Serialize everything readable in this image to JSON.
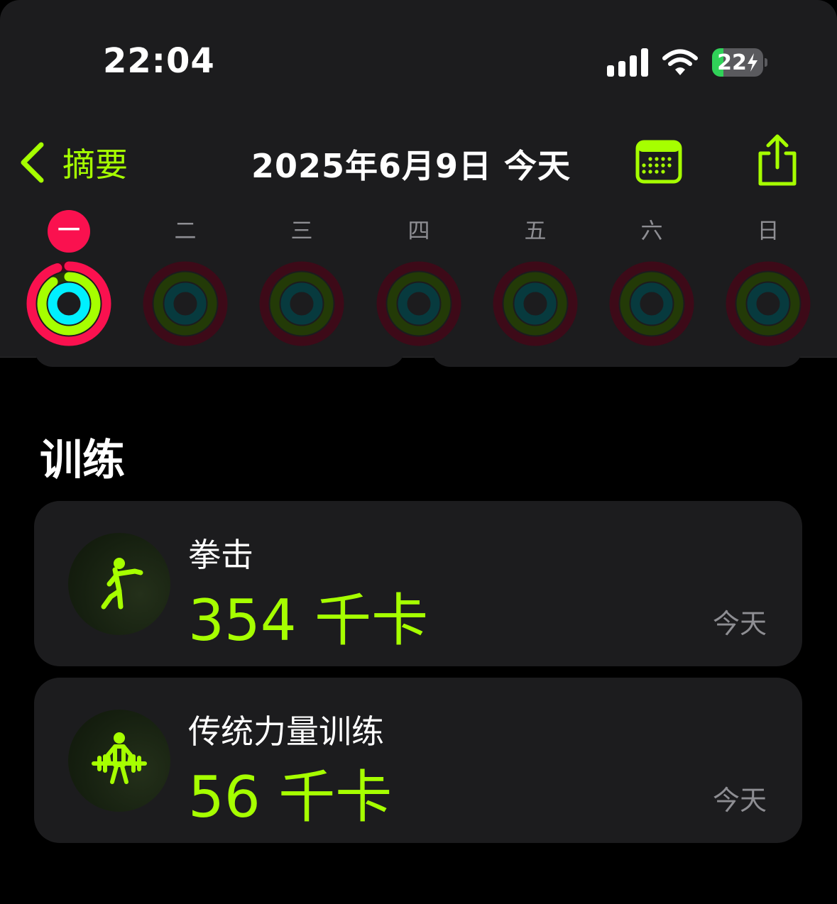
{
  "status_bar": {
    "time": "22:04",
    "battery": "22",
    "battery_level": 0.22
  },
  "nav": {
    "back_label": "摘要",
    "title": "2025年6月9日 今天"
  },
  "week": {
    "days": [
      {
        "label": "一",
        "selected": true,
        "move": 0.95,
        "exercise": 0.9,
        "stand": 1.0
      },
      {
        "label": "二",
        "selected": false,
        "move": 0,
        "exercise": 0,
        "stand": 0
      },
      {
        "label": "三",
        "selected": false,
        "move": 0,
        "exercise": 0,
        "stand": 0
      },
      {
        "label": "四",
        "selected": false,
        "move": 0,
        "exercise": 0,
        "stand": 0
      },
      {
        "label": "五",
        "selected": false,
        "move": 0,
        "exercise": 0,
        "stand": 0
      },
      {
        "label": "六",
        "selected": false,
        "move": 0,
        "exercise": 0,
        "stand": 0
      },
      {
        "label": "日",
        "selected": false,
        "move": 0,
        "exercise": 0,
        "stand": 0
      }
    ]
  },
  "workouts": {
    "title": "训练",
    "items": [
      {
        "name": "拳击",
        "value": "354 千卡",
        "date": "今天",
        "icon": "boxing-icon"
      },
      {
        "name": "传统力量训练",
        "value": "56 千卡",
        "date": "今天",
        "icon": "weightlifting-icon"
      }
    ]
  },
  "colors": {
    "accent": "#a6ff00",
    "move": "#fa114f",
    "exercise": "#a6ff00",
    "stand": "#00f0ff"
  }
}
